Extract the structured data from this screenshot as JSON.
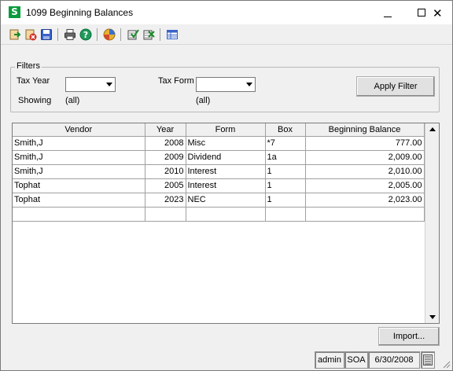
{
  "window": {
    "title": "1099 Beginning Balances",
    "icon_letter": "S",
    "brand_color": "#0a9b3c"
  },
  "toolbar": {
    "icons": [
      "import-icon",
      "delete-icon",
      "save-icon",
      "print-icon",
      "help-icon",
      "refresh-icon",
      "check-icon",
      "uncheck-icon",
      "grid-icon"
    ]
  },
  "filters": {
    "legend": "Filters",
    "tax_year_label": "Tax Year",
    "tax_year_value": "",
    "tax_form_label": "Tax Form",
    "tax_form_value": "",
    "showing_label": "Showing",
    "showing_year": "(all)",
    "showing_form": "(all)",
    "apply_button": "Apply Filter"
  },
  "grid": {
    "columns": [
      "Vendor",
      "Year",
      "Form",
      "Box",
      "Beginning Balance"
    ],
    "rows": [
      [
        "Smith,J",
        "2008",
        "Misc",
        "*7",
        "777.00"
      ],
      [
        "Smith,J",
        "2009",
        "Dividend",
        "1a",
        "2,009.00"
      ],
      [
        "Smith,J",
        "2010",
        "Interest",
        "1",
        "2,010.00"
      ],
      [
        "Tophat",
        "2005",
        "Interest",
        "1",
        "2,005.00"
      ],
      [
        "Tophat",
        "2023",
        "NEC",
        "1",
        "2,023.00"
      ],
      [
        "",
        "",
        "",
        "",
        ""
      ]
    ]
  },
  "import_button": "Import...",
  "status": {
    "user": "admin",
    "company": "SOA",
    "date": "6/30/2008"
  }
}
